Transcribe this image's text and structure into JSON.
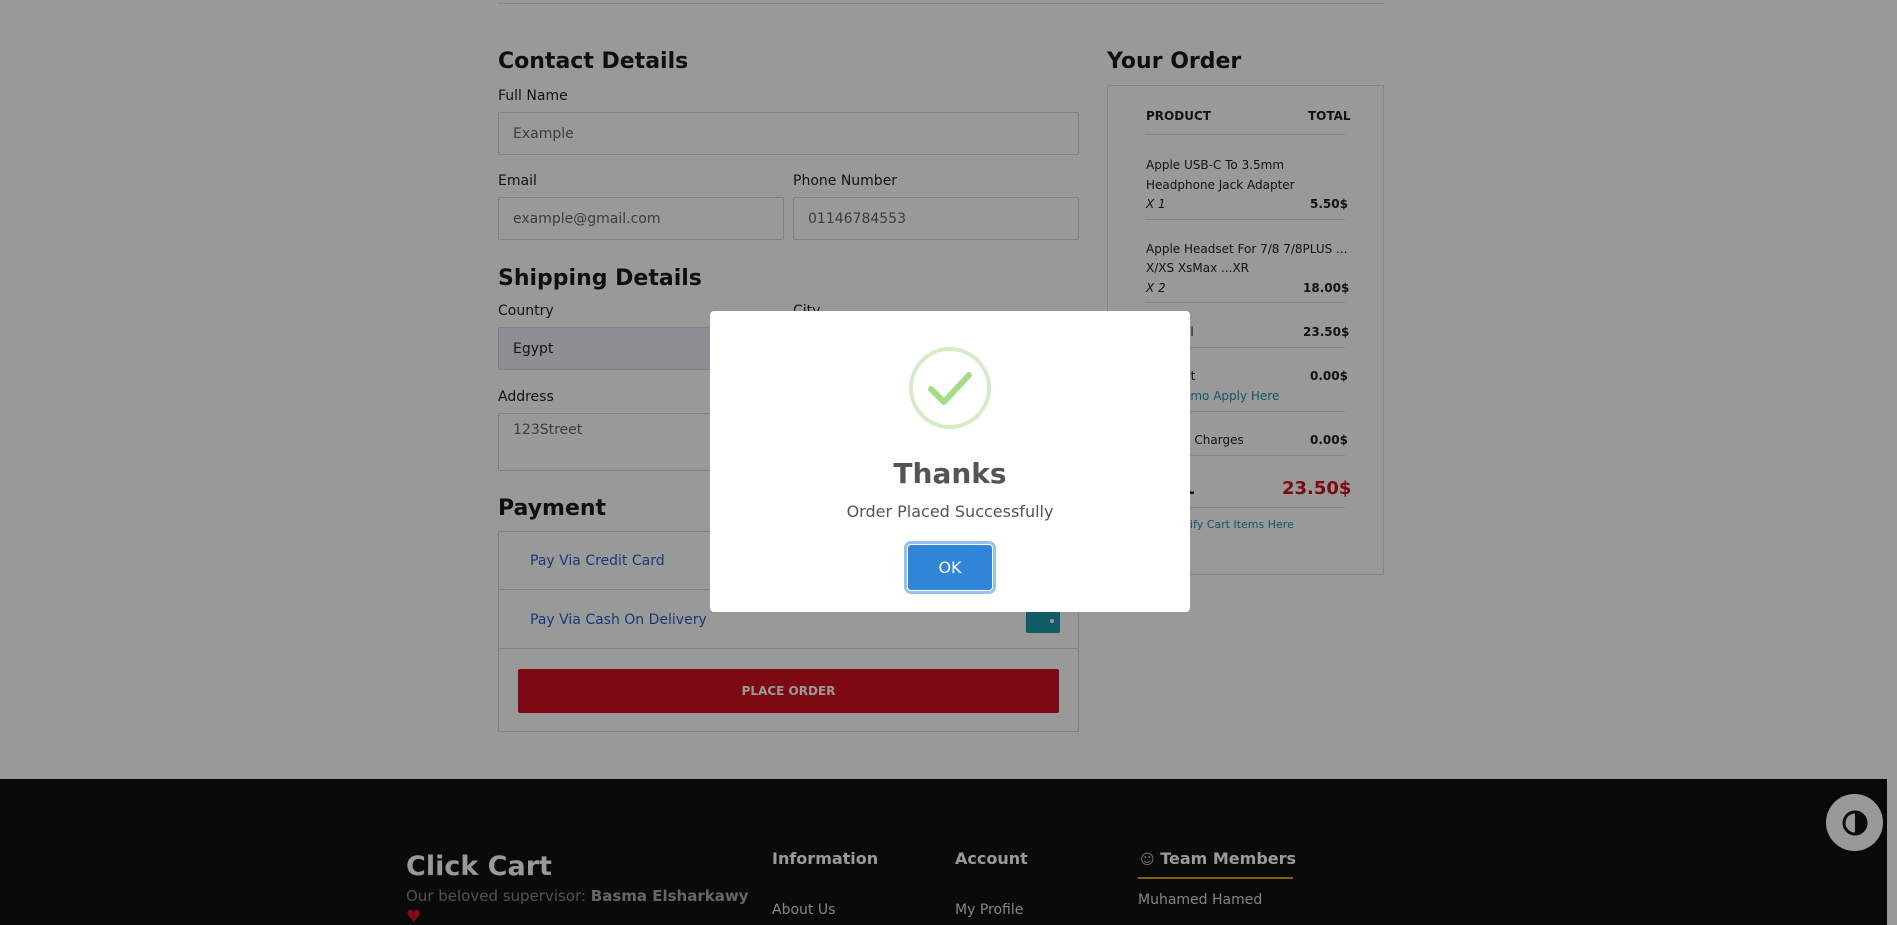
{
  "contact": {
    "title": "Contact Details",
    "full_name_label": "Full Name",
    "full_name_value": "Example",
    "email_label": "Email",
    "email_value": "example@gmail.com",
    "phone_label": "Phone Number",
    "phone_value": "01146784553"
  },
  "shipping": {
    "title": "Shipping Details",
    "country_label": "Country",
    "country_value": "Egypt",
    "city_label": "City",
    "address_label": "Address",
    "address_value": "123Street"
  },
  "payment": {
    "title": "Payment",
    "credit_card_label": "Pay Via Credit Card",
    "cash_label": "Pay Via Cash On Delivery",
    "place_order_label": "PLACE ORDER"
  },
  "order": {
    "title": "Your Order",
    "product_header": "PRODUCT",
    "total_header": "TOTAL",
    "items": [
      {
        "name_line1": "Apple USB-C To 3.5mm",
        "name_line2": "Headphone Jack Adapter",
        "qty": "X 1",
        "price": "5.50$"
      },
      {
        "name_line1": "Apple Headset For 7/8 7/8PLUS ...",
        "name_line2": "X/XS XsMax ...XR",
        "qty": "X 2",
        "price": "18.00$"
      }
    ],
    "subtotal_label": "al",
    "subtotal_value": "23.50$",
    "discount_label": "nt",
    "discount_value": "0.00$",
    "promo_link": "omo Apply Here",
    "shipping_label": "g Charges",
    "shipping_value": "0.00$",
    "total_label": "L",
    "total_value": "23.50$",
    "modify_link": "dify Cart Items Here"
  },
  "footer": {
    "brand": "Click Cart",
    "supervisor_prefix": "Our beloved supervisor:",
    "supervisor_name": "Basma Elsharkawy",
    "info_title": "Information",
    "info_link": "About Us",
    "account_title": "Account",
    "account_link": "My Profile",
    "team_title": "Team Members",
    "team_member": "Muhamed Hamed"
  },
  "modal": {
    "title": "Thanks",
    "message": "Order Placed Successfully",
    "ok_label": "OK"
  },
  "colors": {
    "accent_red": "#d1121e",
    "accent_blue": "#3085d6",
    "teal": "#1f97a8",
    "success_green": "#a5dc86"
  },
  "icons": {
    "success": "check-icon",
    "contrast": "contrast-icon",
    "team": "team-icon",
    "heart": "heart-icon"
  }
}
